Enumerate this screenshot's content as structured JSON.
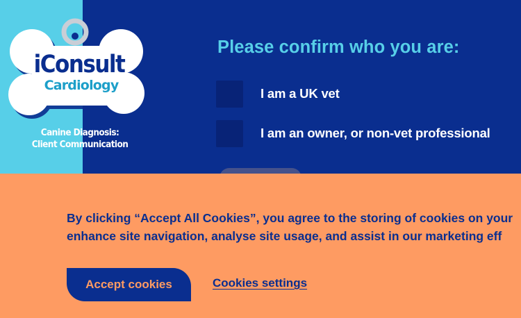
{
  "logo": {
    "title": "iConsult",
    "subtitle": "Cardiology",
    "tagline_line1": "Canine Diagnosis:",
    "tagline_line2": "Client Communication"
  },
  "confirm": {
    "prompt": "Please confirm who you are:",
    "options": [
      {
        "label": "I am a UK vet"
      },
      {
        "label": "I am an owner, or non-vet professional"
      }
    ]
  },
  "cookies": {
    "line1": "By clicking “Accept All Cookies”, you agree to the storing of cookies on your",
    "line2": "enhance site navigation, analyse site usage, and assist in our marketing eff",
    "accept_label": "Accept cookies",
    "settings_label": "Cookies settings"
  },
  "colors": {
    "dark_blue": "#0a2e8f",
    "light_blue": "#57cfe8",
    "orange": "#fe9b62",
    "white": "#ffffff"
  }
}
